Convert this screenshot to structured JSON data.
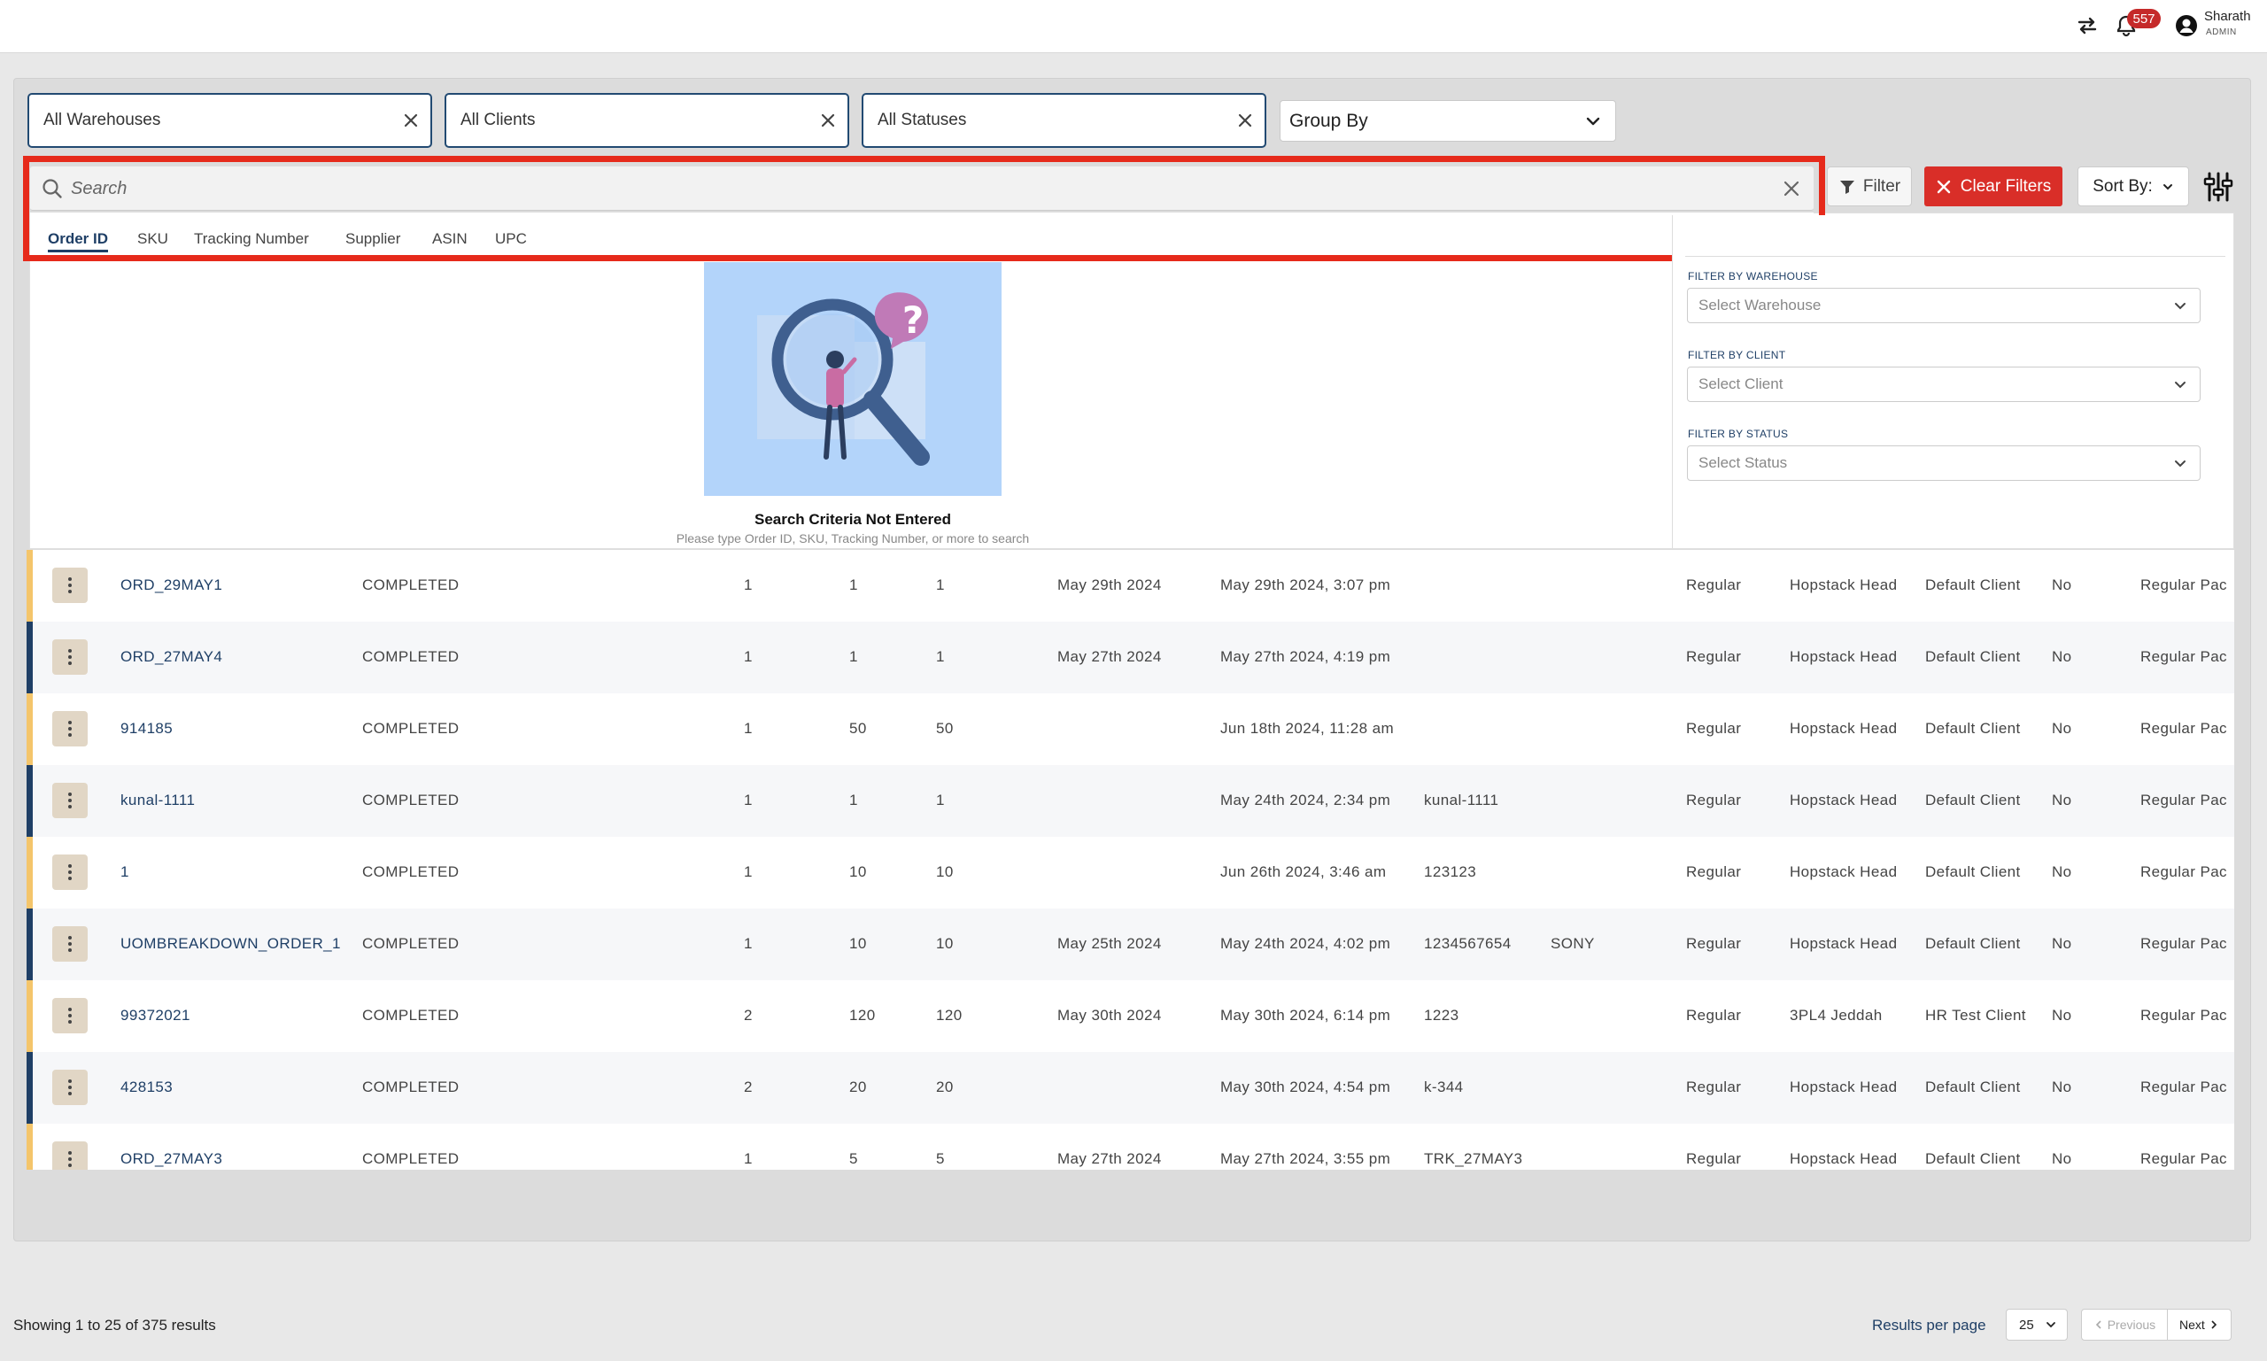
{
  "header": {
    "notification_count": "557",
    "user_name": "Sharath",
    "user_role": "ADMIN"
  },
  "filters_bar": {
    "warehouses": "All Warehouses",
    "clients": "All Clients",
    "statuses": "All Statuses",
    "group_by": "Group By"
  },
  "search": {
    "placeholder": "Search",
    "tabs": [
      "Order ID",
      "SKU",
      "Tracking Number",
      "Supplier",
      "ASIN",
      "UPC"
    ],
    "active_tab": "Order ID"
  },
  "toolbar": {
    "filter_label": "Filter",
    "clear_filters_label": "Clear Filters",
    "sort_label": "Sort By:"
  },
  "empty_state": {
    "title": "Search Criteria Not Entered",
    "subtitle": "Please type Order ID, SKU, Tracking Number, or more to search"
  },
  "filter_panel": {
    "warehouse_label": "FILTER BY WAREHOUSE",
    "warehouse_placeholder": "Select Warehouse",
    "client_label": "FILTER BY CLIENT",
    "client_placeholder": "Select Client",
    "status_label": "FILTER BY STATUS",
    "status_placeholder": "Select Status"
  },
  "orders": [
    {
      "id": "ORD_29MAY1",
      "status": "COMPLETED",
      "c1": "1",
      "c2": "1",
      "c3": "1",
      "date1": "May 29th 2024",
      "date2": "May 29th 2024, 3:07 pm",
      "tracking": "",
      "supplier": "",
      "type": "Regular",
      "warehouse": "Hopstack Head",
      "client": "Default Client",
      "flag": "No",
      "pack": "Regular Pac",
      "stripe": "#f4c56b"
    },
    {
      "id": "ORD_27MAY4",
      "status": "COMPLETED",
      "c1": "1",
      "c2": "1",
      "c3": "1",
      "date1": "May 27th 2024",
      "date2": "May 27th 2024, 4:19 pm",
      "tracking": "",
      "supplier": "",
      "type": "Regular",
      "warehouse": "Hopstack Head",
      "client": "Default Client",
      "flag": "No",
      "pack": "Regular Pac",
      "stripe": "#1f3f66"
    },
    {
      "id": "914185",
      "status": "COMPLETED",
      "c1": "1",
      "c2": "50",
      "c3": "50",
      "date1": "",
      "date2": "Jun 18th 2024, 11:28 am",
      "tracking": "",
      "supplier": "",
      "type": "Regular",
      "warehouse": "Hopstack Head",
      "client": "Default Client",
      "flag": "No",
      "pack": "Regular Pac",
      "stripe": "#f4c56b"
    },
    {
      "id": "kunal-1111",
      "status": "COMPLETED",
      "c1": "1",
      "c2": "1",
      "c3": "1",
      "date1": "",
      "date2": "May 24th 2024, 2:34 pm",
      "tracking": "kunal-1111",
      "supplier": "",
      "type": "Regular",
      "warehouse": "Hopstack Head",
      "client": "Default Client",
      "flag": "No",
      "pack": "Regular Pac",
      "stripe": "#1f3f66"
    },
    {
      "id": "1",
      "status": "COMPLETED",
      "c1": "1",
      "c2": "10",
      "c3": "10",
      "date1": "",
      "date2": "Jun 26th 2024, 3:46 am",
      "tracking": "123123",
      "supplier": "",
      "type": "Regular",
      "warehouse": "Hopstack Head",
      "client": "Default Client",
      "flag": "No",
      "pack": "Regular Pac",
      "stripe": "#f4c56b"
    },
    {
      "id": "UOMBREAKDOWN_ORDER_1",
      "status": "COMPLETED",
      "c1": "1",
      "c2": "10",
      "c3": "10",
      "date1": "May 25th 2024",
      "date2": "May 24th 2024, 4:02 pm",
      "tracking": "1234567654",
      "supplier": "SONY",
      "type": "Regular",
      "warehouse": "Hopstack Head",
      "client": "Default Client",
      "flag": "No",
      "pack": "Regular Pac",
      "stripe": "#1f3f66"
    },
    {
      "id": "99372021",
      "status": "COMPLETED",
      "c1": "2",
      "c2": "120",
      "c3": "120",
      "date1": "May 30th 2024",
      "date2": "May 30th 2024, 6:14 pm",
      "tracking": "1223",
      "supplier": "",
      "type": "Regular",
      "warehouse": "3PL4 Jeddah",
      "client": "HR Test Client",
      "flag": "No",
      "pack": "Regular Pac",
      "stripe": "#f4c56b"
    },
    {
      "id": "428153",
      "status": "COMPLETED",
      "c1": "2",
      "c2": "20",
      "c3": "20",
      "date1": "",
      "date2": "May 30th 2024, 4:54 pm",
      "tracking": "k-344",
      "supplier": "",
      "type": "Regular",
      "warehouse": "Hopstack Head",
      "client": "Default Client",
      "flag": "No",
      "pack": "Regular Pac",
      "stripe": "#1f3f66"
    },
    {
      "id": "ORD_27MAY3",
      "status": "COMPLETED",
      "c1": "1",
      "c2": "5",
      "c3": "5",
      "date1": "May 27th 2024",
      "date2": "May 27th 2024, 3:55 pm",
      "tracking": "TRK_27MAY3",
      "supplier": "",
      "type": "Regular",
      "warehouse": "Hopstack Head",
      "client": "Default Client",
      "flag": "No",
      "pack": "Regular Pac",
      "stripe": "#f4c56b"
    }
  ],
  "footer": {
    "showing": "Showing 1 to 25 of 375 results",
    "results_per_page_label": "Results per page",
    "per_page_value": "25",
    "previous_label": "Previous",
    "next_label": "Next"
  }
}
